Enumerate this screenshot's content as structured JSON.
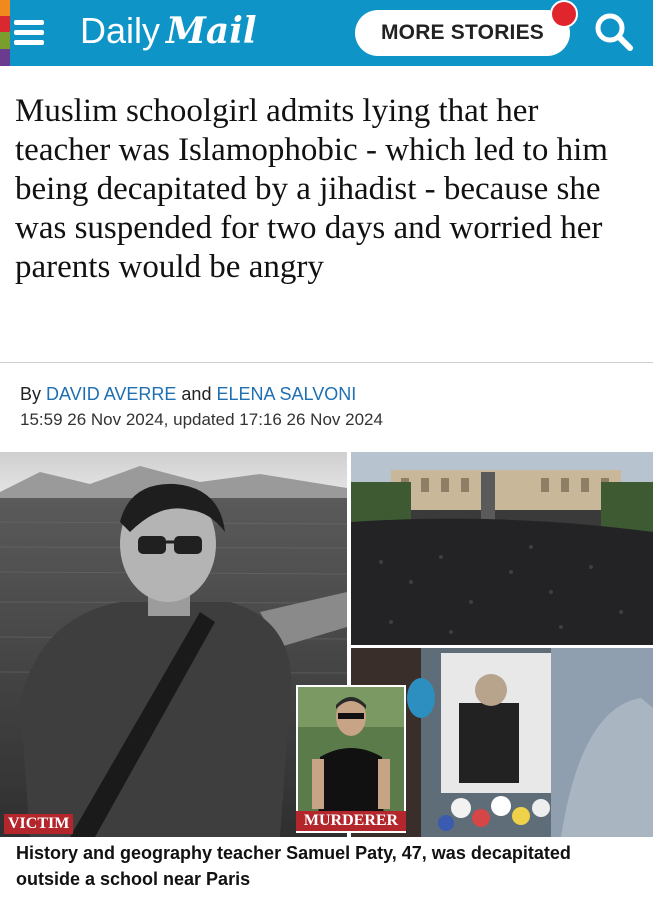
{
  "header": {
    "logo_daily": "Daily",
    "logo_mail": "Mail",
    "more_stories_label": "MORE STORIES",
    "brand_color": "#0f94c8",
    "notification_color": "#e0262c"
  },
  "article": {
    "headline": "Muslim schoolgirl admits lying that her teacher was Islamophobic - which led to him being decapitated by a jihadist - because she was suspended for two days and worried her parents would be angry",
    "byline_prefix": "By",
    "author_1": "DAVID AVERRE",
    "byline_joiner": "and",
    "author_2": "ELENA SALVONI",
    "timestamp": "15:59 26 Nov 2024, updated 17:16 26 Nov 2024"
  },
  "images": {
    "victim_label": "VICTIM",
    "murderer_label": "MURDERER"
  },
  "caption": "History and geography teacher Samuel Paty, 47, was decapitated outside a school near Paris",
  "icons": [
    "hamburger-menu-icon",
    "search-icon"
  ]
}
